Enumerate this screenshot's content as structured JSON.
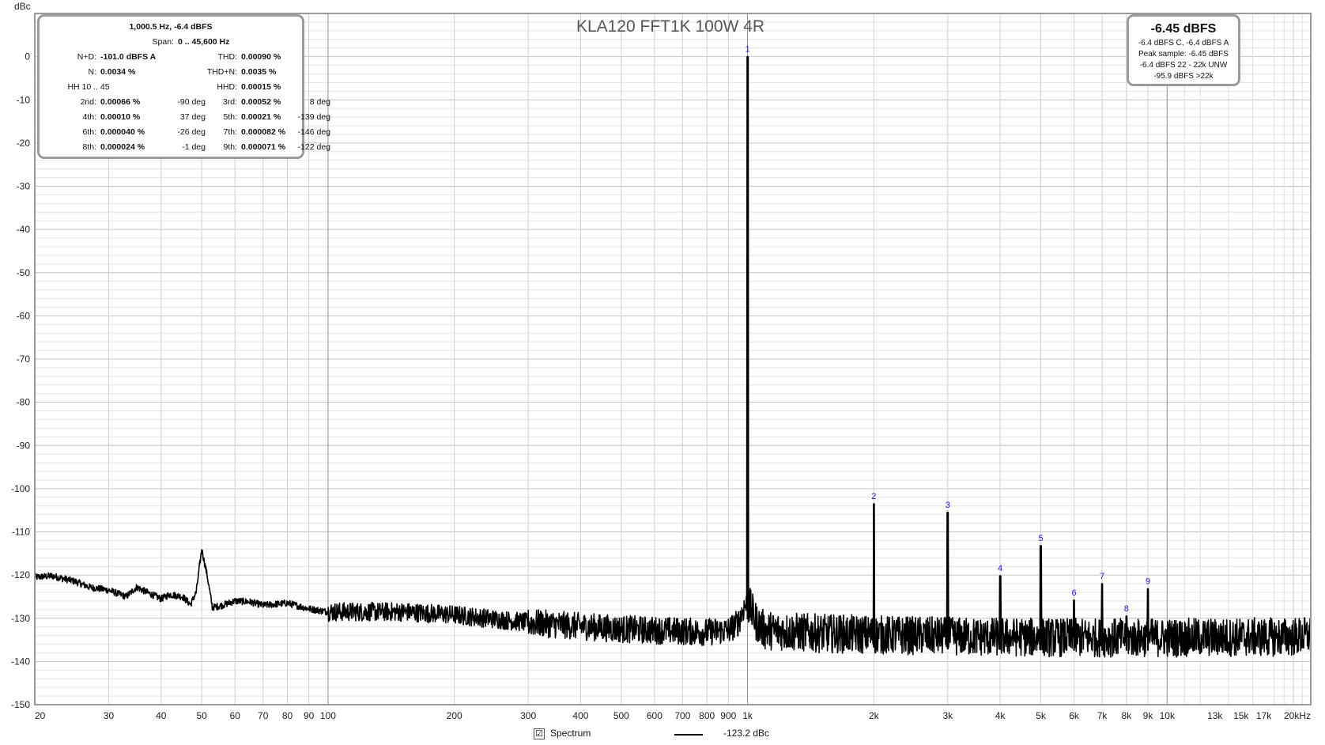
{
  "chart_data": {
    "type": "line",
    "title": "KLA120 FFT1K 100W 4R",
    "ylabel": "dBc",
    "xlabel": "",
    "xscale": "log",
    "xlim": [
      20,
      22000
    ],
    "ylim": [
      -150,
      10
    ],
    "yticks": [
      0,
      -10,
      -20,
      -30,
      -40,
      -50,
      -60,
      -70,
      -80,
      -90,
      -100,
      -110,
      -120,
      -130,
      -140,
      -150
    ],
    "xticks": [
      {
        "v": 20,
        "label": "20"
      },
      {
        "v": 30,
        "label": "30"
      },
      {
        "v": 40,
        "label": "40"
      },
      {
        "v": 50,
        "label": "50"
      },
      {
        "v": 60,
        "label": "60"
      },
      {
        "v": 70,
        "label": "70"
      },
      {
        "v": 80,
        "label": "80"
      },
      {
        "v": 90,
        "label": "90"
      },
      {
        "v": 100,
        "label": "100"
      },
      {
        "v": 200,
        "label": "200"
      },
      {
        "v": 300,
        "label": "300"
      },
      {
        "v": 400,
        "label": "400"
      },
      {
        "v": 500,
        "label": "500"
      },
      {
        "v": 600,
        "label": "600"
      },
      {
        "v": 700,
        "label": "700"
      },
      {
        "v": 800,
        "label": "800"
      },
      {
        "v": 900,
        "label": "900"
      },
      {
        "v": 1000,
        "label": "1k"
      },
      {
        "v": 2000,
        "label": "2k"
      },
      {
        "v": 3000,
        "label": "3k"
      },
      {
        "v": 4000,
        "label": "4k"
      },
      {
        "v": 5000,
        "label": "5k"
      },
      {
        "v": 6000,
        "label": "6k"
      },
      {
        "v": 7000,
        "label": "7k"
      },
      {
        "v": 8000,
        "label": "8k"
      },
      {
        "v": 9000,
        "label": "9k"
      },
      {
        "v": 10000,
        "label": "10k"
      },
      {
        "v": 13000,
        "label": "13k"
      },
      {
        "v": 15000,
        "label": "15k"
      },
      {
        "v": 17000,
        "label": "17k"
      },
      {
        "v": 20000,
        "label": "20kHz"
      }
    ],
    "grid": true,
    "series": [
      {
        "name": "Spectrum",
        "color": "#000000",
        "noise_floor": [
          [
            20,
            -120.5
          ],
          [
            22,
            -120.2
          ],
          [
            25,
            -121.5
          ],
          [
            27,
            -122.8
          ],
          [
            30,
            -123.5
          ],
          [
            33,
            -125
          ],
          [
            35,
            -122.8
          ],
          [
            37,
            -124
          ],
          [
            40,
            -125.5
          ],
          [
            42,
            -124.5
          ],
          [
            45,
            -125
          ],
          [
            47,
            -126.8
          ],
          [
            48.5,
            -124
          ],
          [
            50,
            -114
          ],
          [
            51.5,
            -120
          ],
          [
            53,
            -127.5
          ],
          [
            56,
            -127
          ],
          [
            60,
            -126
          ],
          [
            65,
            -126.2
          ],
          [
            70,
            -127
          ],
          [
            80,
            -126.5
          ],
          [
            90,
            -127.8
          ],
          [
            100,
            -128.5
          ],
          [
            150,
            -128.5
          ],
          [
            200,
            -129.2
          ],
          [
            300,
            -131
          ],
          [
            500,
            -132.5
          ],
          [
            800,
            -133.2
          ],
          [
            900,
            -132.8
          ],
          [
            950,
            -131
          ],
          [
            985,
            -127
          ],
          [
            1015,
            -127.5
          ],
          [
            1050,
            -131
          ],
          [
            1100,
            -132.8
          ],
          [
            1500,
            -133.5
          ],
          [
            3000,
            -134.2
          ],
          [
            6000,
            -134.5
          ],
          [
            10000,
            -134.5
          ],
          [
            20000,
            -134.3
          ],
          [
            22000,
            -134
          ]
        ],
        "harmonics": [
          {
            "label": "1",
            "freq": 1000,
            "level": 0
          },
          {
            "label": "2",
            "freq": 2000,
            "level": -103.5
          },
          {
            "label": "3",
            "freq": 3000,
            "level": -105.5
          },
          {
            "label": "4",
            "freq": 4000,
            "level": -120.2
          },
          {
            "label": "5",
            "freq": 5000,
            "level": -113.2
          },
          {
            "label": "6",
            "freq": 6000,
            "level": -125.8
          },
          {
            "label": "7",
            "freq": 7000,
            "level": -122.0
          },
          {
            "label": "8",
            "freq": 8000,
            "level": -129.5
          },
          {
            "label": "9",
            "freq": 9000,
            "level": -123.2
          }
        ]
      }
    ]
  },
  "distortion_box": {
    "header1": "1,000.5 Hz, -6.4 dBFS",
    "header2_label": "Span:",
    "header2_value": "0 .. 45,600 Hz",
    "rows": [
      {
        "l1": "N+D:",
        "v1": "-101.0 dBFS A",
        "d1": "",
        "l2": "THD:",
        "v2": "0.00090 %",
        "d2": ""
      },
      {
        "l1": "N:",
        "v1": "0.0034 %",
        "d1": "",
        "l2": "THD+N:",
        "v2": "0.0035 %",
        "d2": ""
      },
      {
        "l1": "HH 10 .. 45",
        "v1": "",
        "d1": "",
        "l2": "HHD:",
        "v2": "0.00015 %",
        "d2": ""
      },
      {
        "l1": "2nd:",
        "v1": "0.00066 %",
        "d1": "-90 deg",
        "l2": "3rd:",
        "v2": "0.00052 %",
        "d2": "8 deg"
      },
      {
        "l1": "4th:",
        "v1": "0.00010 %",
        "d1": "37 deg",
        "l2": "5th:",
        "v2": "0.00021 %",
        "d2": "-139 deg"
      },
      {
        "l1": "6th:",
        "v1": "0.000040 %",
        "d1": "-26 deg",
        "l2": "7th:",
        "v2": "0.000082 %",
        "d2": "-146 deg"
      },
      {
        "l1": "8th:",
        "v1": "0.000024 %",
        "d1": "-1 deg",
        "l2": "9th:",
        "v2": "0.000071 %",
        "d2": "-122 deg"
      }
    ]
  },
  "level_box": {
    "main": "-6.45 dBFS",
    "lines": [
      "-6.4 dBFS C, -6.4 dBFS A",
      "Peak sample: -6.45 dBFS",
      "-6.4 dBFS 22 - 22k UNW",
      "-95.9 dBFS >22k"
    ]
  },
  "legend": {
    "checkbox": "☑",
    "name": "Spectrum",
    "value": "-123.2 dBc"
  }
}
